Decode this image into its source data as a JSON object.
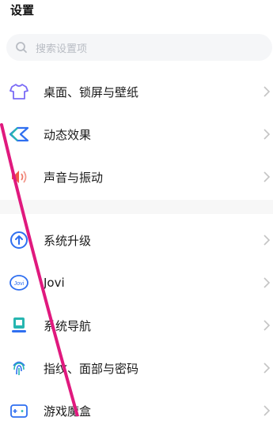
{
  "header": {
    "title": "设置"
  },
  "search": {
    "placeholder": "搜索设置项"
  },
  "items": [
    {
      "label": "桌面、锁屏与壁纸",
      "icon": "tshirt-icon"
    },
    {
      "label": "动态效果",
      "icon": "diamond-icon"
    },
    {
      "label": "声音与振动",
      "icon": "speaker-icon"
    },
    {
      "label": "系统升级",
      "icon": "upgrade-arrow-icon"
    },
    {
      "label": "Jovi",
      "icon": "jovi-icon"
    },
    {
      "label": "系统导航",
      "icon": "navigation-icon"
    },
    {
      "label": "指纹、面部与密码",
      "icon": "fingerprint-icon"
    },
    {
      "label": "游戏魔盒",
      "icon": "game-box-icon"
    }
  ],
  "colors": {
    "accent_purple": "#7b6cf6",
    "accent_blue": "#2f6ff0",
    "accent_red": "#f05a48",
    "accent_teal": "#27b6b0",
    "annotation_stroke": "#e0197e"
  }
}
